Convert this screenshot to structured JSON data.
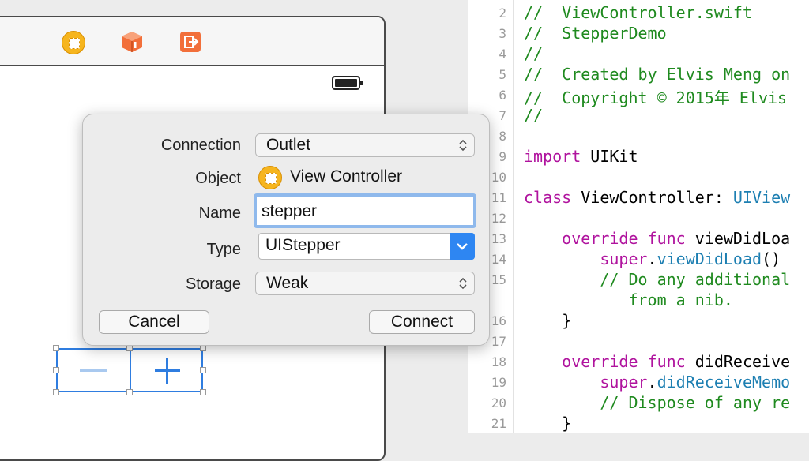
{
  "editor": {
    "lines": [
      {
        "num": "2",
        "text": "//  ViewController.swift"
      },
      {
        "num": "3",
        "text": "//  StepperDemo"
      },
      {
        "num": "4",
        "text": "//"
      },
      {
        "num": "5",
        "text": "//  Created by Elvis Meng on"
      },
      {
        "num": "6",
        "text": "//  Copyright © 2015年 Elvis"
      },
      {
        "num": "7",
        "text": "//"
      },
      {
        "num": "8",
        "text": ""
      },
      {
        "num": "9",
        "text": "import UIKit"
      },
      {
        "num": "10",
        "text": ""
      },
      {
        "num": "11",
        "text": "class ViewController: UIView"
      },
      {
        "num": "12",
        "text": ""
      },
      {
        "num": "13",
        "text": "    override func viewDidLoa"
      },
      {
        "num": "14",
        "text": "        super.viewDidLoad()"
      },
      {
        "num": "15",
        "text": "        // Do any additional"
      },
      {
        "num": "",
        "text": "           from a nib."
      },
      {
        "num": "16",
        "text": "    }"
      },
      {
        "num": "17",
        "text": ""
      },
      {
        "num": "18",
        "text": "    override func didReceive"
      },
      {
        "num": "19",
        "text": "        super.didReceiveMemo"
      },
      {
        "num": "20",
        "text": "        // Dispose of any re"
      },
      {
        "num": "21",
        "text": "    }"
      }
    ]
  },
  "popover": {
    "connection_label": "Connection",
    "connection_value": "Outlet",
    "object_label": "Object",
    "object_value": "View Controller",
    "name_label": "Name",
    "name_value": "stepper",
    "type_label": "Type",
    "type_value": "UIStepper",
    "storage_label": "Storage",
    "storage_value": "Weak",
    "cancel_label": "Cancel",
    "connect_label": "Connect"
  },
  "colors": {
    "comment": "#1f8a1f",
    "keyword": "#b0139e",
    "type": "#1d7fb2",
    "accent": "#2e86f2",
    "selection": "#2f7de0"
  },
  "icons": [
    "view-controller-icon",
    "first-responder-icon",
    "exit-icon",
    "battery-icon",
    "chevron-updown-icon",
    "chevron-down-icon"
  ]
}
